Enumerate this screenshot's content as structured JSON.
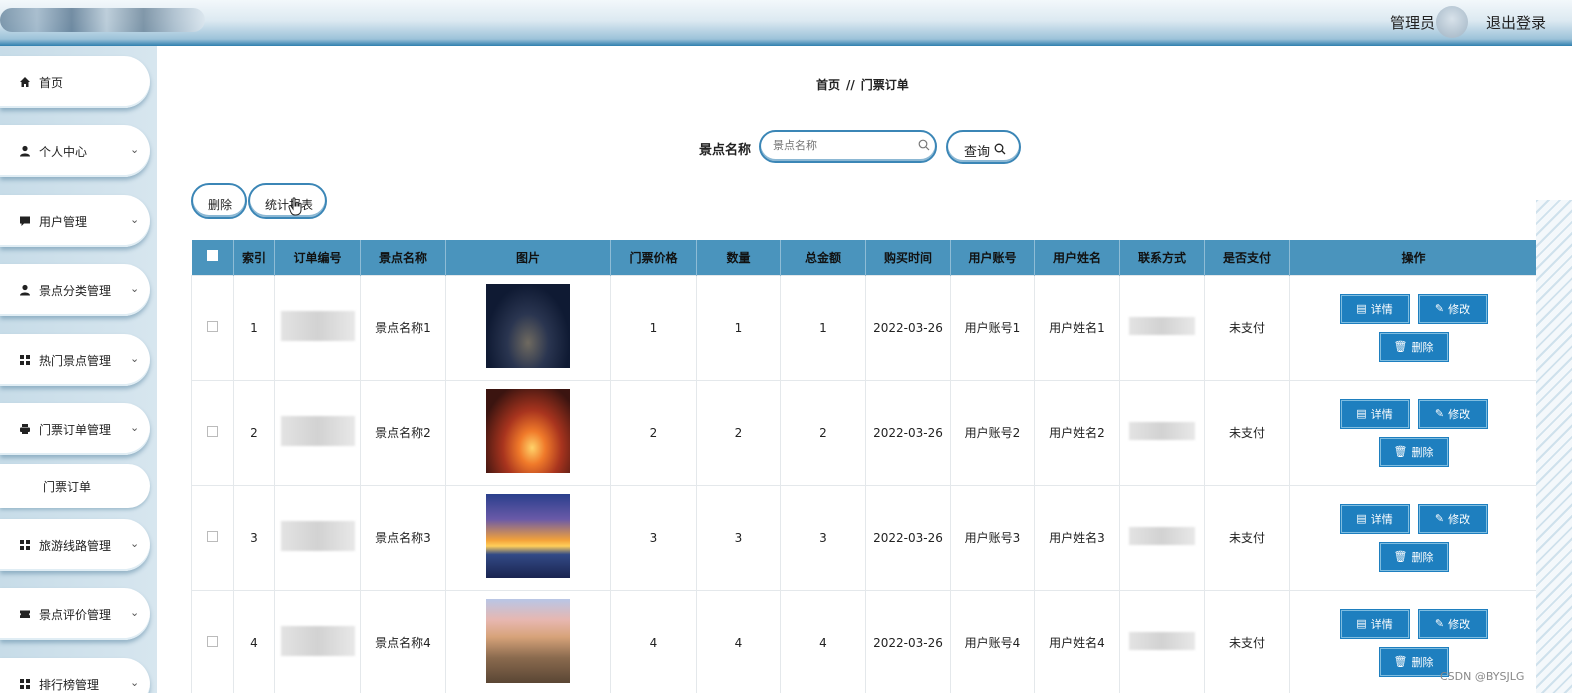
{
  "header": {
    "admin_label": "管理员",
    "logout": "退出登录"
  },
  "sidebar": {
    "items": [
      {
        "label": "首页",
        "icon": "home-icon",
        "expandable": false
      },
      {
        "label": "个人中心",
        "icon": "user-icon",
        "expandable": true
      },
      {
        "label": "用户管理",
        "icon": "chat-icon",
        "expandable": true
      },
      {
        "label": "景点分类管理",
        "icon": "user-icon",
        "expandable": true
      },
      {
        "label": "热门景点管理",
        "icon": "grid-icon",
        "expandable": true
      },
      {
        "label": "门票订单管理",
        "icon": "printer-icon",
        "expandable": true
      },
      {
        "label": "旅游线路管理",
        "icon": "grid-icon",
        "expandable": true
      },
      {
        "label": "景点评价管理",
        "icon": "ticket-icon",
        "expandable": true
      },
      {
        "label": "排行榜管理",
        "icon": "grid-icon",
        "expandable": true
      }
    ],
    "active_sub": "门票订单"
  },
  "breadcrumb": {
    "home": "首页",
    "sep": "//",
    "current": "门票订单"
  },
  "search": {
    "label": "景点名称",
    "placeholder": "景点名称",
    "query_button": "查询"
  },
  "actions": {
    "delete": "删除",
    "stats": "统计报表"
  },
  "table": {
    "headers": [
      "索引",
      "订单编号",
      "景点名称",
      "图片",
      "门票价格",
      "数量",
      "总金额",
      "购买时间",
      "用户账号",
      "用户姓名",
      "联系方式",
      "是否支付",
      "操作"
    ],
    "rows": [
      {
        "index": "1",
        "scenic_name": "景点名称1",
        "price": "1",
        "quantity": "1",
        "total": "1",
        "time": "2022-03-26",
        "account": "用户账号1",
        "user_name": "用户姓名1",
        "paid": "未支付"
      },
      {
        "index": "2",
        "scenic_name": "景点名称2",
        "price": "2",
        "quantity": "2",
        "total": "2",
        "time": "2022-03-26",
        "account": "用户账号2",
        "user_name": "用户姓名2",
        "paid": "未支付"
      },
      {
        "index": "3",
        "scenic_name": "景点名称3",
        "price": "3",
        "quantity": "3",
        "total": "3",
        "time": "2022-03-26",
        "account": "用户账号3",
        "user_name": "用户姓名3",
        "paid": "未支付"
      },
      {
        "index": "4",
        "scenic_name": "景点名称4",
        "price": "4",
        "quantity": "4",
        "total": "4",
        "time": "2022-03-26",
        "account": "用户账号4",
        "user_name": "用户姓名4",
        "paid": "未支付"
      }
    ],
    "row_actions": {
      "detail": "详情",
      "edit": "修改",
      "delete": "删除"
    }
  },
  "watermark": "CSDN @BYSJLG",
  "colors": {
    "header_bar": "#2f7fae",
    "table_header": "#4a94bd",
    "action_button": "#1e7fbf"
  }
}
